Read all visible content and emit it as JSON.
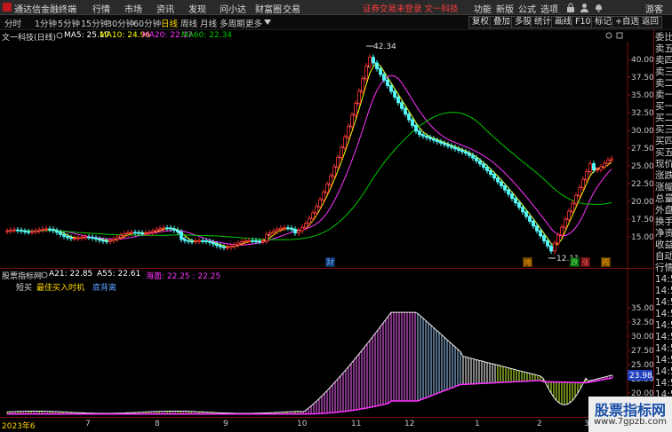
{
  "titlebar": {
    "app_title": "通达信金融终端",
    "menu": [
      "行情",
      "市场",
      "资讯",
      "发现",
      "问小达",
      "财富圈",
      "交易"
    ],
    "notice": "证券交易未登录  文一科技",
    "right_menu": [
      "功能",
      "新版",
      "公式",
      "选项"
    ],
    "guest": "游客"
  },
  "toolbar": {
    "periods": [
      "分时",
      "1分钟",
      "5分钟",
      "15分钟",
      "30分钟",
      "60分钟",
      "日线",
      "周线",
      "月线",
      "多周期",
      "更多"
    ],
    "active_period": "日线",
    "buttons": [
      "复权",
      "叠加",
      "多股",
      "统计",
      "画线",
      "F10",
      "标记",
      "+自选",
      "返回"
    ]
  },
  "info": {
    "stock": "文一科技(日线)",
    "ma5": "MA5: 25.17",
    "ma10": "MA10: 24.96",
    "ma20": "MA20: 22.17",
    "ma60": "MA60: 22.34"
  },
  "colors": {
    "up": "#ff3232",
    "down": "#54ffff",
    "ma5": "#ffffff",
    "ma10": "#ffff00",
    "ma20": "#ff33ff",
    "ma60": "#00cc00",
    "axis": "#7a1010"
  },
  "price_axis": [
    "40.00",
    "37.50",
    "35.00",
    "32.50",
    "30.00",
    "27.50",
    "25.00",
    "22.50",
    "20.00",
    "17.50",
    "15.00"
  ],
  "annotations": {
    "high": "42.34",
    "low": "12.11",
    "event_marks": [
      "财",
      "摊",
      "跌",
      "涨",
      "腾"
    ]
  },
  "indicator": {
    "name": "股票指标网",
    "a21": "A21: 22.85",
    "a55": "A55: 22.61",
    "sea": "海面: 22.25 : 22.25",
    "signal_buy": "短买",
    "signal_best": "最佳买入时机",
    "signal_bottom": "底背离",
    "axis": [
      "35.00",
      "32.50",
      "30.00",
      "27.50",
      "25.00",
      "22.50",
      "20.00",
      "17.50"
    ],
    "current": "23.98"
  },
  "dates": [
    "2023年6",
    "7",
    "8",
    "9",
    "10",
    "11",
    "12",
    "1",
    "2",
    "3"
  ],
  "quote_panel": [
    "委比",
    "卖五",
    "卖四",
    "卖三",
    "卖二",
    "卖一",
    "买一",
    "买二",
    "买三",
    "买四",
    "买五",
    "现价",
    "涨跌",
    "涨幅",
    "总量",
    "外盘",
    "换手",
    "净资",
    "收益",
    "自动",
    "行情",
    "14:5",
    "14:5",
    "14:5",
    "14:5",
    "14:5",
    "14:5",
    "14:5",
    "14:5",
    "14:5",
    "14:5",
    "14:5",
    "14:5"
  ],
  "watermark": {
    "text": "股票指标网",
    "url": "www.7gpzb.com"
  }
}
